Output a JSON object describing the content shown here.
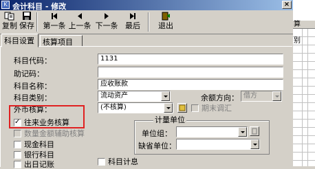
{
  "window": {
    "title": "会计科目 - 修改",
    "close_symbol": "×"
  },
  "toolbar": {
    "copy": "复制",
    "save": "保存",
    "first": "第一条",
    "prev": "上一条",
    "next": "下一条",
    "last": "最后",
    "exit": "退出"
  },
  "tabs": [
    "科目设置",
    "核算项目"
  ],
  "form": {
    "code_label": "科目代码：",
    "code_value": "1131",
    "mnemonic_label": "助记码：",
    "mnemonic_value": "",
    "name_label": "科目名称：",
    "name_value": "应收账款",
    "category_label": "科目类别：",
    "category_value": "流动资产",
    "balance_dir_label": "余额方向：",
    "balance_dir_value": "借方",
    "currency_label": "外币核算：",
    "currency_value": "(不核算)",
    "period_end_label": "期末调汇"
  },
  "checkboxes": {
    "ar_ap": "往来业务核算",
    "qty_aux": "数量金额辅助核算",
    "cash": "现金科目",
    "bank": "银行科目",
    "journal": "出日记账",
    "account_calc": "科目计息"
  },
  "measure": {
    "group_title": "计量单位",
    "unit_group_label": "单位组：",
    "default_unit_label": "缺省单位："
  },
  "background_grid": {
    "header": "算",
    "cells": [
      "",
      "别",
      "",
      "",
      "",
      "",
      "",
      "",
      "",
      "",
      "",
      "",
      "",
      "",
      "",
      ""
    ]
  },
  "colors": {
    "highlight": "#e02020",
    "title_start": "#0a246a",
    "title_end": "#a6caf0"
  }
}
